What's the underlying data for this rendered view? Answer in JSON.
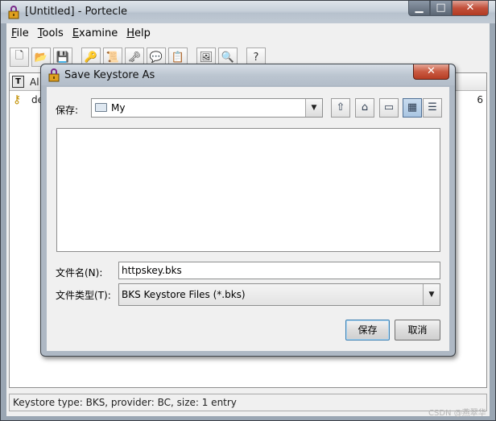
{
  "main_window": {
    "title": "[Untitled] - Portecle",
    "controls": {
      "minimize": "▁",
      "maximize": "□",
      "close": "✕"
    }
  },
  "menubar": {
    "items": [
      {
        "label": "File",
        "mnemonic": "F",
        "rest": "ile"
      },
      {
        "label": "Tools",
        "mnemonic": "T",
        "rest": "ools"
      },
      {
        "label": "Examine",
        "mnemonic": "E",
        "rest": "xamine"
      },
      {
        "label": "Help",
        "mnemonic": "H",
        "rest": "elp"
      }
    ]
  },
  "toolbar": {
    "buttons": [
      {
        "icon": "new-keystore-icon",
        "glyph": "🗋"
      },
      {
        "icon": "open-keystore-icon",
        "glyph": "📂"
      },
      {
        "icon": "save-keystore-icon",
        "glyph": "💾"
      },
      {
        "icon": "generate-keypair-icon",
        "glyph": "🔑"
      },
      {
        "icon": "import-certificate-icon",
        "glyph": "📜"
      },
      {
        "icon": "import-keypair-icon",
        "glyph": "🗝"
      },
      {
        "icon": "set-password-icon",
        "glyph": "💬"
      },
      {
        "icon": "keystore-report-icon",
        "glyph": "📋"
      },
      {
        "icon": "examine-certificate-icon",
        "glyph": "🖼"
      },
      {
        "icon": "examine-crl-icon",
        "glyph": "🔍"
      },
      {
        "icon": "help-icon",
        "glyph": "?"
      }
    ]
  },
  "table": {
    "header_type": "T",
    "header_alias": "Al",
    "rows": [
      {
        "alias": "de",
        "trail": "6"
      }
    ]
  },
  "statusbar": {
    "text": "Keystore type: BKS, provider: BC, size: 1 entry"
  },
  "dialog": {
    "title": "Save Keystore As",
    "close": "✕",
    "save_in_label": "保存:",
    "save_in_value": "My",
    "nav_buttons": [
      {
        "icon": "up-folder-icon",
        "glyph": "⇧"
      },
      {
        "icon": "home-icon",
        "glyph": "⌂"
      },
      {
        "icon": "new-folder-icon",
        "glyph": "▭"
      },
      {
        "icon": "list-view-icon",
        "glyph": "▦",
        "pressed": true
      },
      {
        "icon": "details-view-icon",
        "glyph": "☰"
      }
    ],
    "file_name_label": "文件名(N):",
    "file_name_value": "httpskey.bks",
    "file_type_label": "文件类型(T):",
    "file_type_value": "BKS Keystore Files (*.bks)",
    "save_button": "保存",
    "cancel_button": "取消"
  },
  "watermark": "CSDN @燕翠华"
}
